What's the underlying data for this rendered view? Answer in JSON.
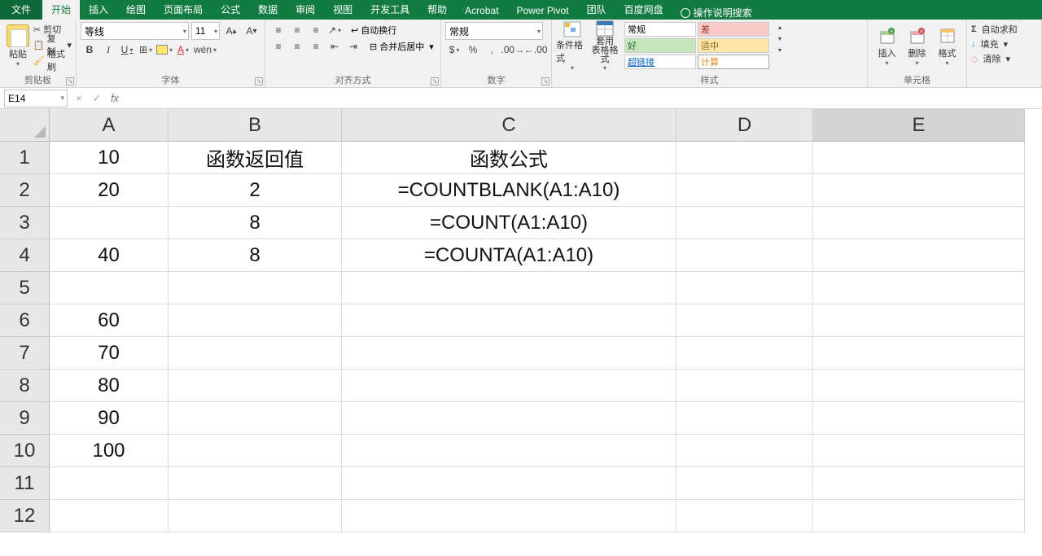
{
  "tabs": {
    "file": "文件",
    "home": "开始",
    "insert": "插入",
    "draw": "绘图",
    "pagelayout": "页面布局",
    "formulas": "公式",
    "data": "数据",
    "review": "审阅",
    "view": "视图",
    "devtools": "开发工具",
    "help": "帮助",
    "acrobat": "Acrobat",
    "powerpivot": "Power Pivot",
    "team": "团队",
    "baidu": "百度网盘",
    "tellme": "操作说明搜索"
  },
  "ribbon": {
    "clipboard": {
      "label": "剪贴板",
      "paste": "粘贴",
      "cut": "剪切",
      "copy": "复制",
      "format": "格式刷"
    },
    "font": {
      "label": "字体",
      "name": "等线",
      "size": "11"
    },
    "align": {
      "label": "对齐方式",
      "wrap": "自动换行",
      "merge": "合并后居中"
    },
    "number": {
      "label": "数字",
      "format": "常规"
    },
    "styles": {
      "label": "样式",
      "condfmt": "条件格式",
      "table": "套用\n表格格式",
      "normal": "常规",
      "bad": "差",
      "good": "好",
      "neutral": "适中",
      "link": "超链接",
      "calc": "计算"
    },
    "cells": {
      "label": "单元格",
      "insert": "插入",
      "delete": "删除",
      "format": "格式"
    },
    "editing": {
      "label": "",
      "sum": "自动求和",
      "fill": "填充",
      "clear": "清除"
    }
  },
  "namebox": "E14",
  "formula": "",
  "columns": [
    "A",
    "B",
    "C",
    "D",
    "E"
  ],
  "rows": [
    "1",
    "2",
    "3",
    "4",
    "5",
    "6",
    "7",
    "8",
    "9",
    "10",
    "11",
    "12"
  ],
  "griddata": [
    {
      "A": "10",
      "B": "函数返回值",
      "C": "函数公式"
    },
    {
      "A": "20",
      "B": "2",
      "C": "=COUNTBLANK(A1:A10)"
    },
    {
      "A": "",
      "B": "8",
      "C": "=COUNT(A1:A10)"
    },
    {
      "A": "40",
      "B": "8",
      "C": "=COUNTA(A1:A10)"
    },
    {
      "A": ""
    },
    {
      "A": "60"
    },
    {
      "A": "70"
    },
    {
      "A": "80"
    },
    {
      "A": "90"
    },
    {
      "A": "100"
    },
    {},
    {}
  ]
}
